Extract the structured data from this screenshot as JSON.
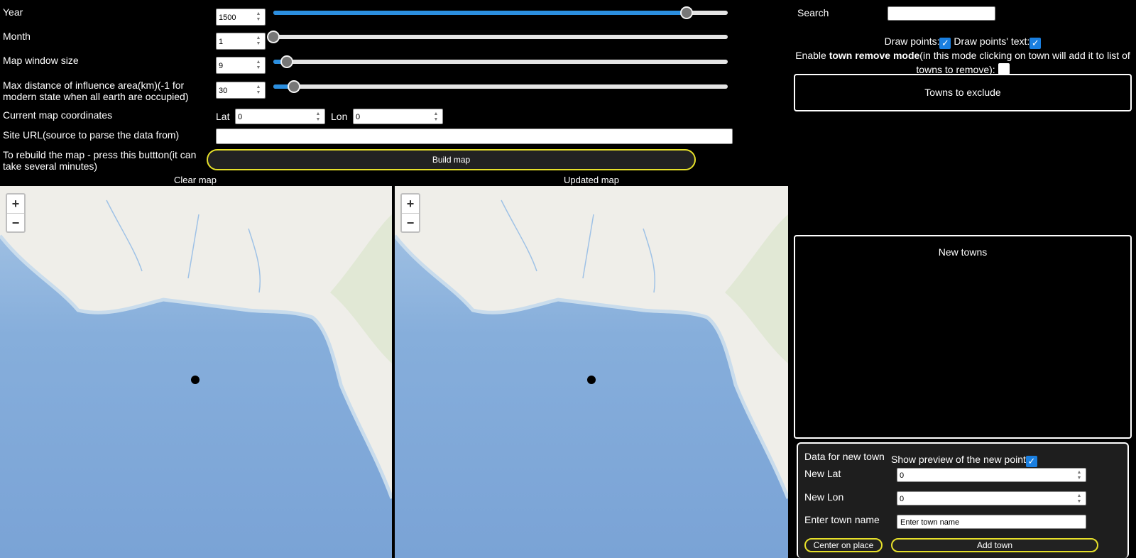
{
  "controls": {
    "year": {
      "label": "Year",
      "value": "1500",
      "slider_fraction": 0.91
    },
    "month": {
      "label": "Month",
      "value": "1",
      "slider_fraction": 0.0
    },
    "window_size": {
      "label": "Map window size",
      "value": "9",
      "slider_fraction": 0.03
    },
    "max_distance": {
      "label": "Max distance of influence area(km)(-1 for modern state when all earth are occupied)",
      "value": "30",
      "slider_fraction": 0.045
    }
  },
  "coordinates": {
    "label": "Current map coordinates",
    "lat_label": "Lat",
    "lat_value": "0",
    "lon_label": "Lon",
    "lon_value": "0"
  },
  "site_url": {
    "label": "Site URL(source to parse the data from)",
    "value": ""
  },
  "rebuild": {
    "label": "To rebuild the map - press this buttton(it can take several minutes)",
    "button": "Build map"
  },
  "maps": {
    "clear_title": "Clear map",
    "updated_title": "Updated map",
    "zoom_in": "+",
    "zoom_out": "−"
  },
  "right": {
    "search_label": "Search",
    "search_value": "",
    "draw_points_label": "Draw points:",
    "draw_points_checked": true,
    "draw_text_label": "Draw points' text:",
    "draw_text_checked": true,
    "remove_mode_prefix": "Enable ",
    "remove_mode_bold": "town remove mode",
    "remove_mode_suffix": "(in this mode clicking on town will add it to list of towns to remove):",
    "remove_mode_checked": false,
    "towns_to_exclude": "Towns to exclude",
    "new_towns": "New towns"
  },
  "new_town": {
    "title": "Data for new town",
    "preview_label": "Show preview of the new point",
    "preview_checked": true,
    "lat_label": "New Lat",
    "lat_value": "0",
    "lon_label": "New Lon",
    "lon_value": "0",
    "name_label": "Enter town name",
    "name_placeholder": "Enter town name",
    "center_button": "Center on place",
    "add_button": "Add town"
  },
  "colors": {
    "accent": "#2b8fe0",
    "button_border": "#e6e02a",
    "background": "#000000"
  },
  "icons": {
    "checkbox": "check-icon",
    "spinner": "spinner-arrows-icon",
    "zoom_in": "plus-icon",
    "zoom_out": "minus-icon"
  }
}
